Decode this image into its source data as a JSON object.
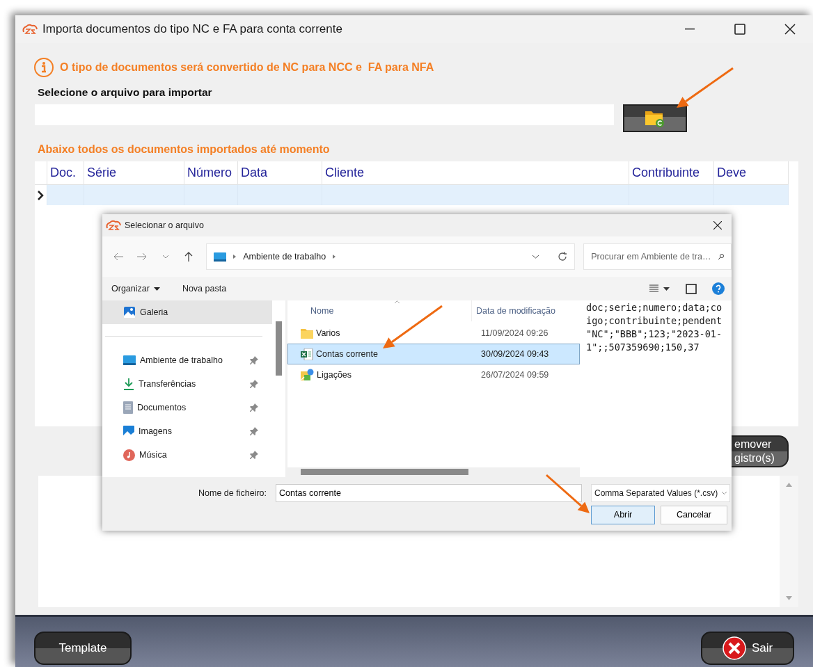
{
  "window": {
    "title": "Importa documentos do tipo NC e FA para conta corrente"
  },
  "info": "O tipo de documentos será convertido de NC para NCC e  FA para NFA",
  "file_label": "Selecione o arquivo para importar",
  "imported_label": "Abaixo todos os documentos importados até momento",
  "table": {
    "columns": [
      "Doc.",
      "Série",
      "Número",
      "Data",
      "Cliente",
      "Contribuinte",
      "Deve"
    ],
    "rows": [
      {
        "selected": true
      }
    ]
  },
  "remove_button": [
    "emover",
    "gistro(s)"
  ],
  "footer_buttons": [
    {
      "label": "Template",
      "kind": "plain"
    },
    {
      "label": "Sair",
      "kind": "exit"
    }
  ],
  "dialog": {
    "title": "Selecionar o arquivo",
    "breadcrumb": [
      "Ambiente de trabalho"
    ],
    "search": {
      "placeholder": "Procurar em Ambiente de tra…"
    },
    "toolbar": [
      {
        "label": "Organizar",
        "kind": "menu"
      },
      {
        "label": "Nova pasta",
        "kind": "plain"
      }
    ],
    "nav_items": [
      {
        "label": "Galeria",
        "kind": "gallery",
        "selected": true,
        "pinned": false
      },
      {
        "label": "Ambiente de trabalho",
        "kind": "desktop",
        "selected": false,
        "pinned": true
      },
      {
        "label": "Transferências",
        "kind": "download",
        "selected": false,
        "pinned": true
      },
      {
        "label": "Documentos",
        "kind": "documents",
        "selected": false,
        "pinned": true
      },
      {
        "label": "Imagens",
        "kind": "images",
        "selected": false,
        "pinned": true
      },
      {
        "label": "Música",
        "kind": "music",
        "selected": false,
        "pinned": true
      }
    ],
    "columns": [
      "Nome",
      "Data de modificação"
    ],
    "files": [
      {
        "name": "Varios",
        "kind": "folder",
        "modified": "11/09/2024 09:26",
        "selected": false
      },
      {
        "name": "Contas corrente",
        "kind": "excel",
        "modified": "30/09/2024 09:43",
        "selected": true
      },
      {
        "name": "Ligações",
        "kind": "shortcut",
        "modified": "26/07/2024 09:59",
        "selected": false
      }
    ],
    "preview": [
      "doc;serie;numero;data;co",
      "igo;contribuinte;pendent",
      "\"NC\";\"BBB\";123;\"2023-01-",
      "1\";;507359690;150,37"
    ],
    "filename_label": "Nome de ficheiro:",
    "filename": "Contas corrente",
    "filetype": "Comma Separated Values (*.csv)",
    "buttons": [
      {
        "label": "Abrir",
        "kind": "default"
      },
      {
        "label": "Cancelar",
        "kind": "plain"
      }
    ]
  }
}
